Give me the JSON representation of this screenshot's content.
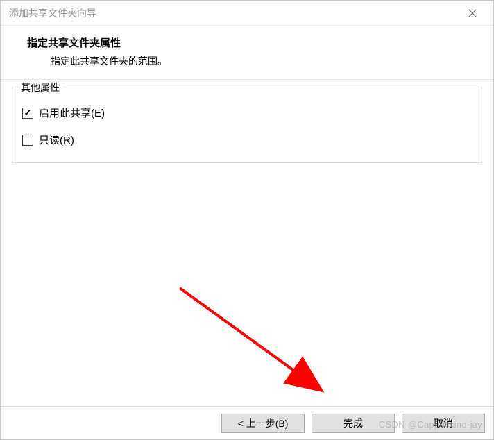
{
  "window": {
    "title": "添加共享文件夹向导"
  },
  "header": {
    "title": "指定共享文件夹属性",
    "subtitle": "指定此共享文件夹的范围。"
  },
  "group": {
    "legend": "其他属性",
    "enable_share": {
      "label": "启用此共享(E)",
      "checked": true
    },
    "read_only": {
      "label": "只读(R)",
      "checked": false
    }
  },
  "buttons": {
    "back": "< 上一步(B)",
    "finish": "完成",
    "cancel": "取消"
  },
  "watermark": "CSDN @Cappuccino-jay",
  "annotation": {
    "arrow_color": "#ff0000"
  }
}
